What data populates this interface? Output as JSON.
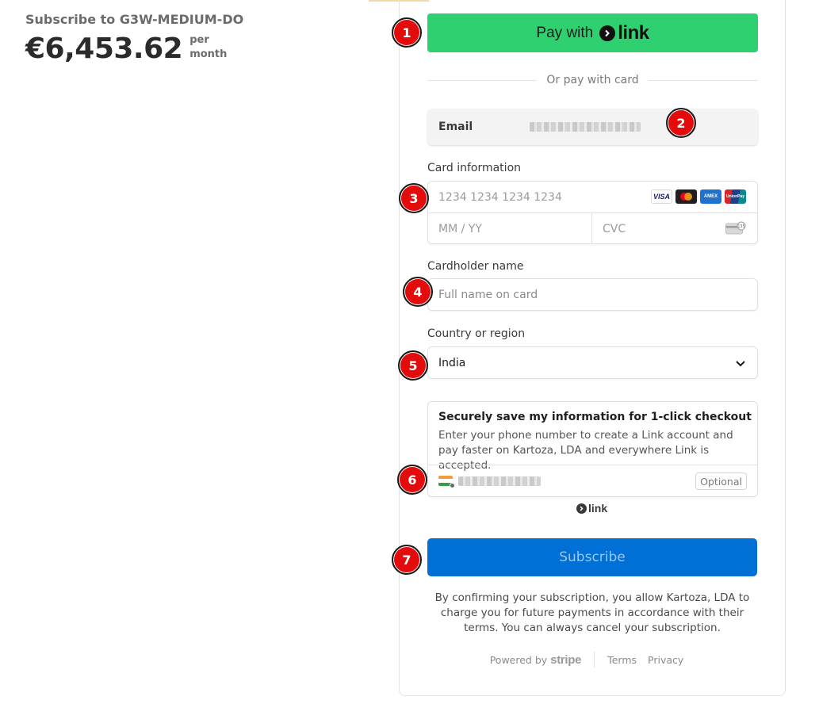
{
  "summary": {
    "subscribe_to": "Subscribe to G3W-MEDIUM-DO",
    "price": "€6,453.62",
    "per": "per",
    "period": "month"
  },
  "pay_with_link": {
    "label": "Pay with",
    "brand": "link"
  },
  "divider": {
    "text": "Or pay with card"
  },
  "email": {
    "label": "Email"
  },
  "card": {
    "label": "Card information",
    "number_placeholder": "1234 1234 1234 1234",
    "expiry_placeholder": "MM / YY",
    "cvc_placeholder": "CVC",
    "brands": [
      "VISA",
      "mastercard",
      "AMEX",
      "UnionPay"
    ]
  },
  "cardholder": {
    "label": "Cardholder name",
    "placeholder": "Full name on card"
  },
  "country": {
    "label": "Country or region",
    "value": "India"
  },
  "save_info": {
    "title": "Securely save my information for 1-click checkout",
    "description": "Enter your phone number to create a Link account and pay faster on Kartoza, LDA and everywhere Link is accepted.",
    "optional_label": "Optional"
  },
  "link_footer": {
    "brand": "link"
  },
  "subscribe_button": {
    "label": "Subscribe"
  },
  "legal": {
    "text": "By confirming your subscription, you allow Kartoza, LDA to charge you for future payments in accordance with their terms. You can always cancel your subscription."
  },
  "footer": {
    "powered_by": "Powered by",
    "stripe": "stripe",
    "terms": "Terms",
    "privacy": "Privacy"
  },
  "badges": [
    "1",
    "2",
    "3",
    "4",
    "5",
    "6",
    "7"
  ],
  "colors": {
    "link_green": "#2ed070",
    "subscribe_blue": "#0070d6",
    "badge_red": "#e30b0b"
  }
}
